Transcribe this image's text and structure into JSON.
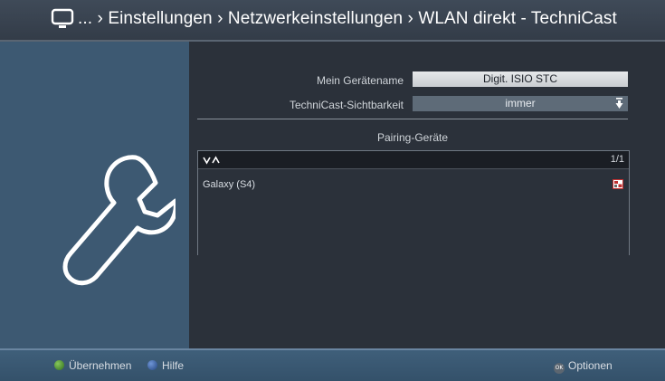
{
  "header": {
    "breadcrumb": "... › Einstellungen › Netzwerkeinstellungen › WLAN direkt - TechniCast"
  },
  "icons": {
    "tv": "tv-icon",
    "sidebar": "wrench-icon",
    "sort": "sort-arrows-icon",
    "device": "device-icon",
    "dropdown": "dropdown-arrow-icon"
  },
  "settings": {
    "device_name_label": "Mein Gerätename",
    "device_name_value": "Digit. ISIO STC",
    "visibility_label": "TechniCast-Sichtbarkeit",
    "visibility_value": "immer"
  },
  "pairing": {
    "title": "Pairing-Geräte",
    "page_count": "1/1",
    "items": [
      {
        "label": "Galaxy (S4)"
      }
    ]
  },
  "footer": {
    "apply_label": "Übernehmen",
    "help_label": "Hilfe",
    "options_label": "Optionen",
    "ok_icon_text": "OK"
  },
  "colors": {
    "sidebar": "#3d5972",
    "main_bg": "#2b313a",
    "footer": "#3f5f7a",
    "green_key": "#4f9a32",
    "blue_key": "#3a64ad"
  }
}
